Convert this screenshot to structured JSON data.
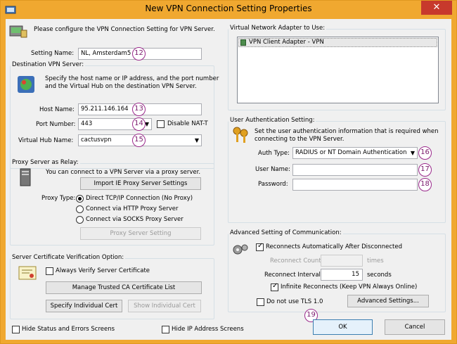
{
  "window": {
    "title": "New VPN Connection Setting Properties",
    "close": "✕"
  },
  "intro": "Please configure the VPN Connection Setting for VPN Server.",
  "setting_name": {
    "label": "Setting Name:",
    "value": "NL, Amsterdam5",
    "badge": "12"
  },
  "destination": {
    "legend": "Destination VPN Server:",
    "desc1": "Specify the host name or IP address, and the port number",
    "desc2": "and the Virtual Hub on the destination VPN Server.",
    "host_label": "Host Name:",
    "host_value": "95.211.146.164",
    "host_badge": "13",
    "port_label": "Port Number:",
    "port_value": "443",
    "port_badge": "14",
    "disable_natt": "Disable NAT-T",
    "hub_label": "Virtual Hub Name:",
    "hub_value": "cactusvpn",
    "hub_badge": "15"
  },
  "proxy": {
    "legend": "Proxy Server as Relay:",
    "desc": "You can connect to a VPN Server via a proxy server.",
    "import_btn": "Import IE Proxy Server Settings",
    "type_label": "Proxy Type:",
    "opt_direct": "Direct TCP/IP Connection (No Proxy)",
    "opt_http": "Connect via HTTP Proxy Server",
    "opt_socks": "Connect via SOCKS Proxy Server",
    "setting_btn": "Proxy Server Setting"
  },
  "cert": {
    "legend": "Server Certificate Verification Option:",
    "always_verify": "Always Verify Server Certificate",
    "manage_btn": "Manage Trusted CA Certificate List",
    "specify_btn": "Specify Individual Cert",
    "show_btn": "Show Individual Cert"
  },
  "bottom": {
    "hide_status": "Hide Status and Errors Screens",
    "hide_ip": "Hide IP Address Screens"
  },
  "adapter": {
    "legend": "Virtual Network Adapter to Use:",
    "item": "VPN Client Adapter - VPN"
  },
  "auth": {
    "legend": "User Authentication Setting:",
    "desc1": "Set the user authentication information that is required when",
    "desc2": "connecting to the VPN Server.",
    "type_label": "Auth Type:",
    "type_value": "RADIUS or NT Domain Authentication",
    "type_badge": "16",
    "user_label": "User Name:",
    "user_value": "",
    "user_badge": "17",
    "pass_label": "Password:",
    "pass_value": "",
    "pass_badge": "18"
  },
  "advanced": {
    "legend": "Advanced Setting of Communication:",
    "reconnect_auto": "Reconnects Automatically After Disconnected",
    "reconnect_count_label": "Reconnect Count:",
    "reconnect_count_unit": "times",
    "reconnect_interval_label": "Reconnect Interval:",
    "reconnect_interval_value": "15",
    "reconnect_interval_unit": "seconds",
    "infinite": "Infinite Reconnects (Keep VPN Always Online)",
    "no_tls": "Do not use TLS 1.0",
    "advanced_btn": "Advanced Settings..."
  },
  "footer": {
    "ok": "OK",
    "ok_badge": "19",
    "cancel": "Cancel"
  }
}
